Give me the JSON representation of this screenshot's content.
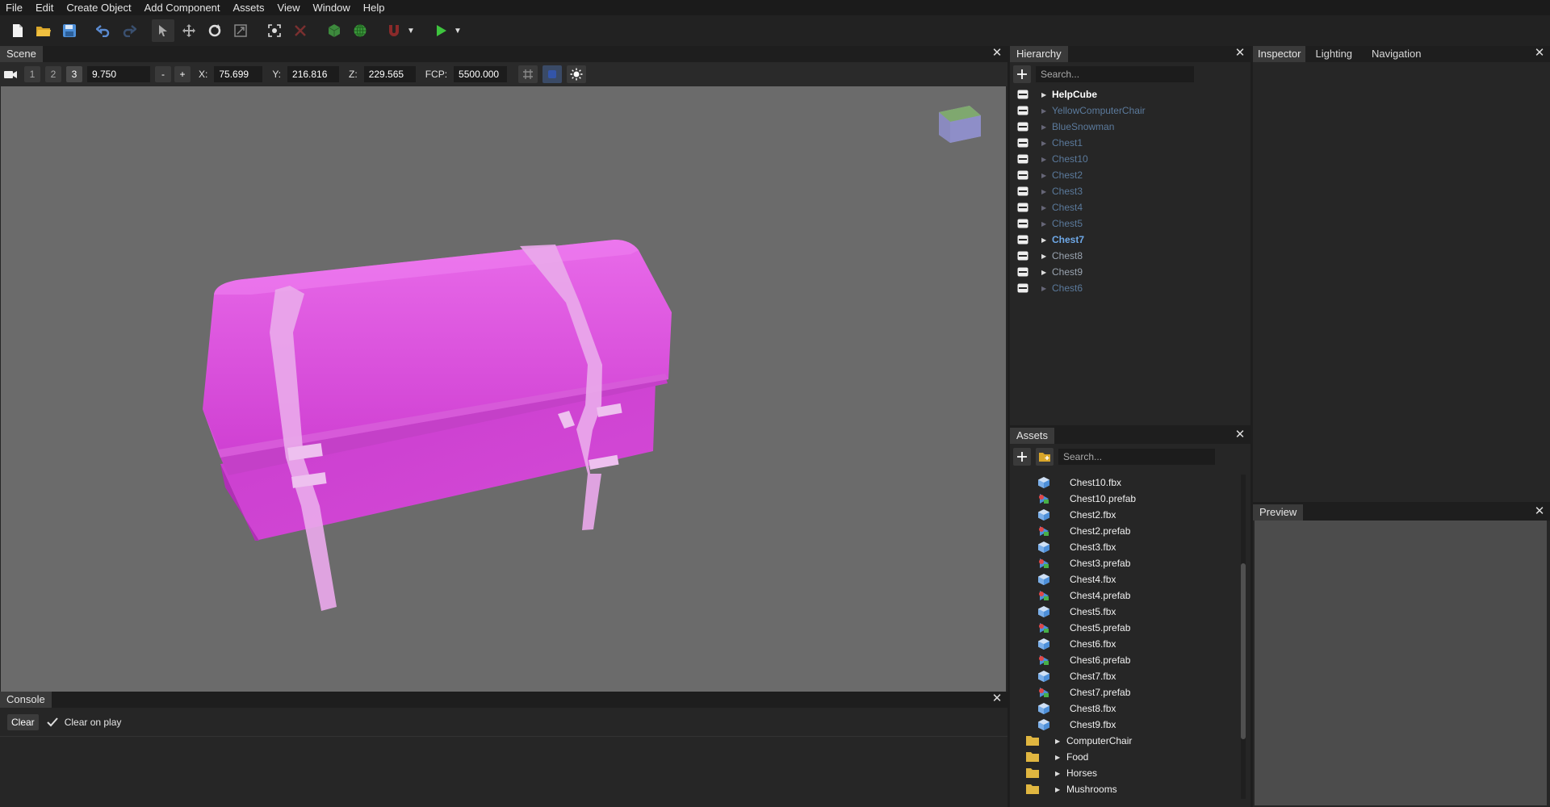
{
  "menu": [
    "File",
    "Edit",
    "Create Object",
    "Add Component",
    "Assets",
    "View",
    "Window",
    "Help"
  ],
  "toolbar": {
    "icons": [
      "new-file-icon",
      "open-folder-icon",
      "save-icon",
      "undo-icon",
      "redo-icon",
      "select-tool-icon",
      "move-tool-icon",
      "rotate-tool-icon",
      "scale-tool-icon",
      "focus-icon",
      "delete-icon",
      "local-space-icon",
      "global-space-icon",
      "snap-magnet-icon",
      "play-icon"
    ]
  },
  "scene": {
    "tab": "Scene",
    "cams": [
      "1",
      "2",
      "3"
    ],
    "speed": "9.750",
    "minus": "-",
    "plus": "+",
    "x_label": "X:",
    "x": "75.699",
    "y_label": "Y:",
    "y": "216.816",
    "z_label": "Z:",
    "z": "229.565",
    "fcp_label": "FCP:",
    "fcp": "5500.000",
    "object_color": "#d64fd8",
    "background": "#6b6b6b"
  },
  "console": {
    "tab": "Console",
    "clear": "Clear",
    "clear_on_play": "Clear on play"
  },
  "hierarchy": {
    "tab": "Hierarchy",
    "search_placeholder": "Search...",
    "items": [
      {
        "label": "HelpCube",
        "color": "#ffffff"
      },
      {
        "label": "YellowComputerChair",
        "color": "#5b7a9c"
      },
      {
        "label": "BlueSnowman",
        "color": "#5b7a9c"
      },
      {
        "label": "Chest1",
        "color": "#5b7a9c"
      },
      {
        "label": "Chest10",
        "color": "#5b7a9c"
      },
      {
        "label": "Chest2",
        "color": "#5b7a9c"
      },
      {
        "label": "Chest3",
        "color": "#5b7a9c"
      },
      {
        "label": "Chest4",
        "color": "#5b7a9c"
      },
      {
        "label": "Chest5",
        "color": "#5b7a9c"
      },
      {
        "label": "Chest7",
        "color": "#6fa9e8"
      },
      {
        "label": "Chest8",
        "color": "#9aa4b0"
      },
      {
        "label": "Chest9",
        "color": "#9aa4b0"
      },
      {
        "label": "Chest6",
        "color": "#5b7a9c"
      }
    ]
  },
  "assets": {
    "tab": "Assets",
    "search_placeholder": "Search...",
    "files": [
      {
        "name": "Chest10.fbx",
        "type": "model"
      },
      {
        "name": "Chest10.prefab",
        "type": "prefab"
      },
      {
        "name": "Chest2.fbx",
        "type": "model"
      },
      {
        "name": "Chest2.prefab",
        "type": "prefab"
      },
      {
        "name": "Chest3.fbx",
        "type": "model"
      },
      {
        "name": "Chest3.prefab",
        "type": "prefab"
      },
      {
        "name": "Chest4.fbx",
        "type": "model"
      },
      {
        "name": "Chest4.prefab",
        "type": "prefab"
      },
      {
        "name": "Chest5.fbx",
        "type": "model"
      },
      {
        "name": "Chest5.prefab",
        "type": "prefab"
      },
      {
        "name": "Chest6.fbx",
        "type": "model"
      },
      {
        "name": "Chest6.prefab",
        "type": "prefab"
      },
      {
        "name": "Chest7.fbx",
        "type": "model"
      },
      {
        "name": "Chest7.prefab",
        "type": "prefab"
      },
      {
        "name": "Chest8.fbx",
        "type": "model"
      },
      {
        "name": "Chest9.fbx",
        "type": "model"
      }
    ],
    "folders": [
      "ComputerChair",
      "Food",
      "Horses",
      "Mushrooms"
    ]
  },
  "inspector": {
    "tabs": [
      "Inspector",
      "Lighting",
      "Navigation"
    ]
  },
  "preview": {
    "tab": "Preview"
  }
}
